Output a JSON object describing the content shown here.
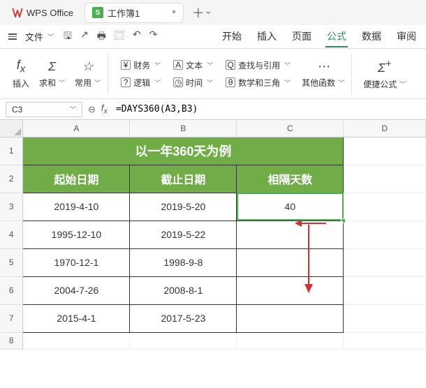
{
  "app": {
    "name": "WPS Office"
  },
  "document": {
    "name": "工作簿1"
  },
  "file_menu_label": "文件",
  "menu_tabs": [
    "开始",
    "插入",
    "页面",
    "公式",
    "数据",
    "审阅"
  ],
  "active_menu_tab": "公式",
  "ribbon": {
    "insert_fn": "插入",
    "autosum": "求和",
    "common": "常用",
    "financial": "财务",
    "logical": "逻辑",
    "text": "文本",
    "datetime": "时间",
    "lookup": "查找与引用",
    "math": "数学和三角",
    "more": "其他函数",
    "quick": "便捷公式"
  },
  "name_box": "C3",
  "formula": "=DAYS360(A3,B3)",
  "columns": [
    "A",
    "B",
    "C",
    "D"
  ],
  "row_numbers": [
    "1",
    "2",
    "3",
    "4",
    "5",
    "6",
    "7",
    "8"
  ],
  "sheet": {
    "title": "以一年360天为例",
    "headers": [
      "起始日期",
      "截止日期",
      "相隔天数"
    ],
    "rows": [
      {
        "start": "2019-4-10",
        "end": "2019-5-20",
        "days": "40"
      },
      {
        "start": "1995-12-10",
        "end": "2019-5-22",
        "days": ""
      },
      {
        "start": "1970-12-1",
        "end": "1998-9-8",
        "days": ""
      },
      {
        "start": "2004-7-26",
        "end": "2008-8-1",
        "days": ""
      },
      {
        "start": "2015-4-1",
        "end": "2017-5-23",
        "days": ""
      }
    ]
  }
}
